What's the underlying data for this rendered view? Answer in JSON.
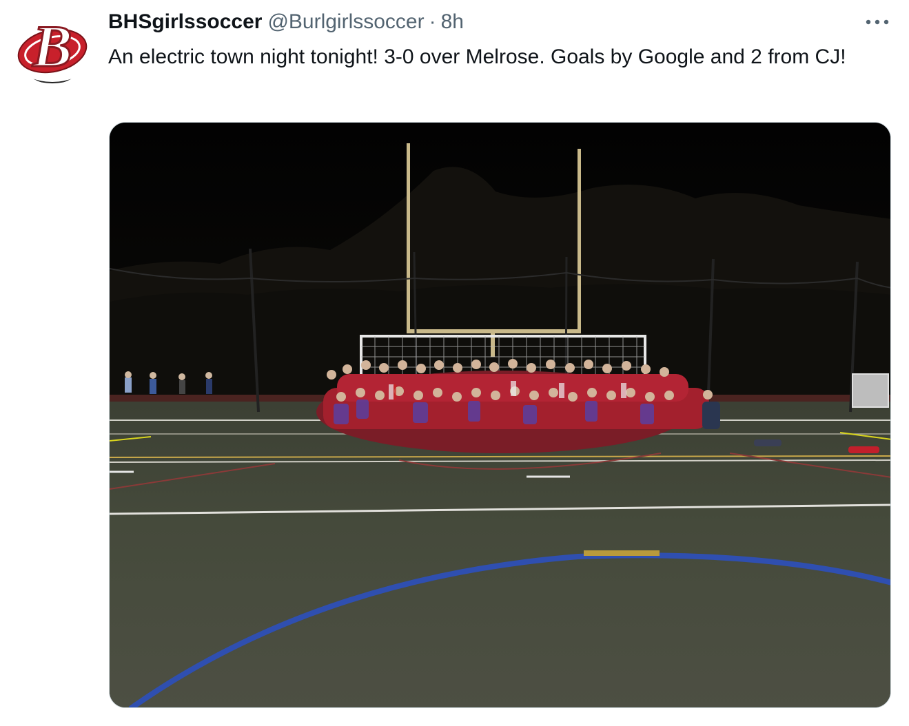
{
  "tweet": {
    "display_name": "BHSgirlssoccer",
    "handle": "@Burlgirlssoccer",
    "separator": "·",
    "time": "8h",
    "text": "An electric town night tonight! 3-0 over Melrose. Goals by Google and 2 from CJ!",
    "avatar_letter": "B",
    "media_alt": "Team photo of the girls soccer team posing in front of the goal on the field at night"
  },
  "colors": {
    "text_primary": "#0f1419",
    "text_secondary": "#536471",
    "border": "#cfd9de",
    "avatar_red": "#c8202b"
  },
  "icons": {
    "more": "more-horizontal-icon"
  }
}
